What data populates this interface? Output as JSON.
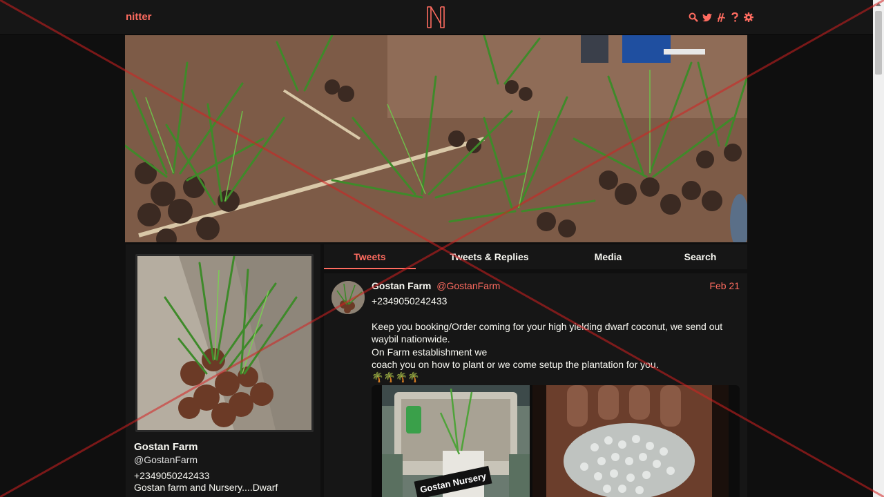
{
  "navbar": {
    "brand": "nitter",
    "logo_letter": "N",
    "icons": [
      "search-icon",
      "twitter-bird-icon",
      "rss-icon",
      "help-icon",
      "gear-icon"
    ]
  },
  "profile": {
    "fullname": "Gostan Farm",
    "username": "@GostanFarm",
    "bio_lines": [
      "+2349050242433",
      "Gostan farm and Nursery....Dwarf"
    ]
  },
  "tabs": [
    {
      "label": "Tweets",
      "active": true
    },
    {
      "label": "Tweets & Replies",
      "active": false
    },
    {
      "label": "Media",
      "active": false
    },
    {
      "label": "Search",
      "active": false
    }
  ],
  "tweet": {
    "fullname": "Gostan Farm",
    "username": "@GostanFarm",
    "date": "Feb 21",
    "content": "+2349050242433\n\nKeep you booking/Order coming for your high yielding dwarf coconut, we send out waybil nationwide.\nOn Farm establishment we\n coach you on how to plant or we come setup the plantation for you.\n🌴🌴🌴🌴",
    "media_caption": "Gostan Nursery"
  },
  "colors": {
    "accent": "#ff6c60",
    "background": "#0f0f0f",
    "panel": "#161616",
    "overlay_x": "#d42020"
  }
}
